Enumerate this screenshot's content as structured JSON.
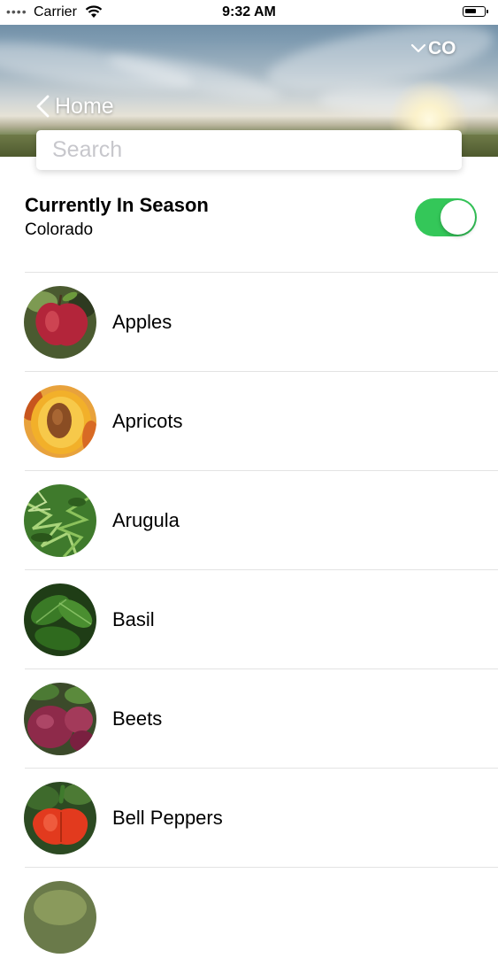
{
  "status_bar": {
    "carrier": "Carrier",
    "time": "9:32 AM"
  },
  "nav": {
    "back_label": "Home",
    "state_label": "CO"
  },
  "search": {
    "placeholder": "Search",
    "value": ""
  },
  "filter": {
    "title": "Currently In Season",
    "subtitle": "Colorado",
    "toggle_on": true,
    "toggle_color": "#34c759"
  },
  "produce": [
    {
      "name": "Apples",
      "icon": "apple-image"
    },
    {
      "name": "Apricots",
      "icon": "apricot-image"
    },
    {
      "name": "Arugula",
      "icon": "arugula-image"
    },
    {
      "name": "Basil",
      "icon": "basil-image"
    },
    {
      "name": "Beets",
      "icon": "beet-image"
    },
    {
      "name": "Bell Peppers",
      "icon": "bell-pepper-image"
    }
  ]
}
